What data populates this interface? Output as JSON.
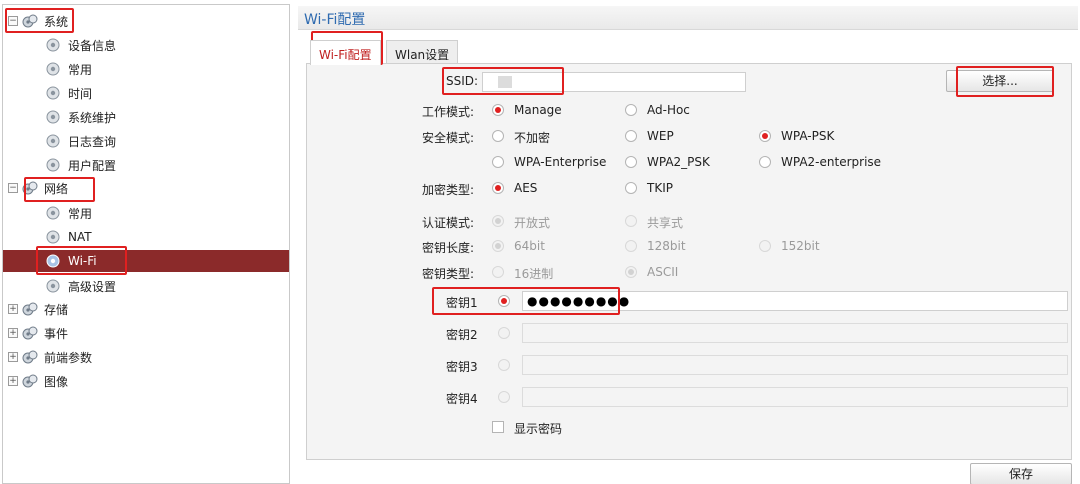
{
  "sidebar": {
    "system": "系统",
    "system_items": [
      "设备信息",
      "常用",
      "时间",
      "系统维护",
      "日志查询",
      "用户配置"
    ],
    "network": "网络",
    "network_items": [
      "常用",
      "NAT",
      "Wi-Fi",
      "高级设置"
    ],
    "storage": "存储",
    "events": "事件",
    "frontend": "前端参数",
    "image": "图像",
    "expand_minus": "−",
    "expand_plus": "+"
  },
  "header": {
    "title": "Wi-Fi配置"
  },
  "tabs": [
    "Wi-Fi配置",
    "Wlan设置"
  ],
  "form": {
    "ssid_label": "SSID:",
    "ssid_value": "",
    "select_button": "选择...",
    "work_mode_label": "工作模式:",
    "work_mode_options": [
      "Manage",
      "Ad-Hoc"
    ],
    "security_label": "安全模式:",
    "security_options": [
      "不加密",
      "WEP",
      "WPA-PSK",
      "WPA-Enterprise",
      "WPA2_PSK",
      "WPA2-enterprise"
    ],
    "encryption_label": "加密类型:",
    "encryption_options": [
      "AES",
      "TKIP"
    ],
    "auth_label": "认证模式:",
    "auth_options": [
      "开放式",
      "共享式"
    ],
    "key_length_label": "密钥长度:",
    "key_length_options": [
      "64bit",
      "128bit",
      "152bit"
    ],
    "key_type_label": "密钥类型:",
    "key_type_options": [
      "16进制",
      "ASCII"
    ],
    "key_labels": [
      "密钥1",
      "密钥2",
      "密钥3",
      "密钥4"
    ],
    "key1_value": "●●●●●●●●●",
    "show_password": "显示密码",
    "save_button": "保存"
  },
  "colors": {
    "accent": "#e02020",
    "selected_bg": "#8b2a2a",
    "title": "#2f6bb0"
  }
}
